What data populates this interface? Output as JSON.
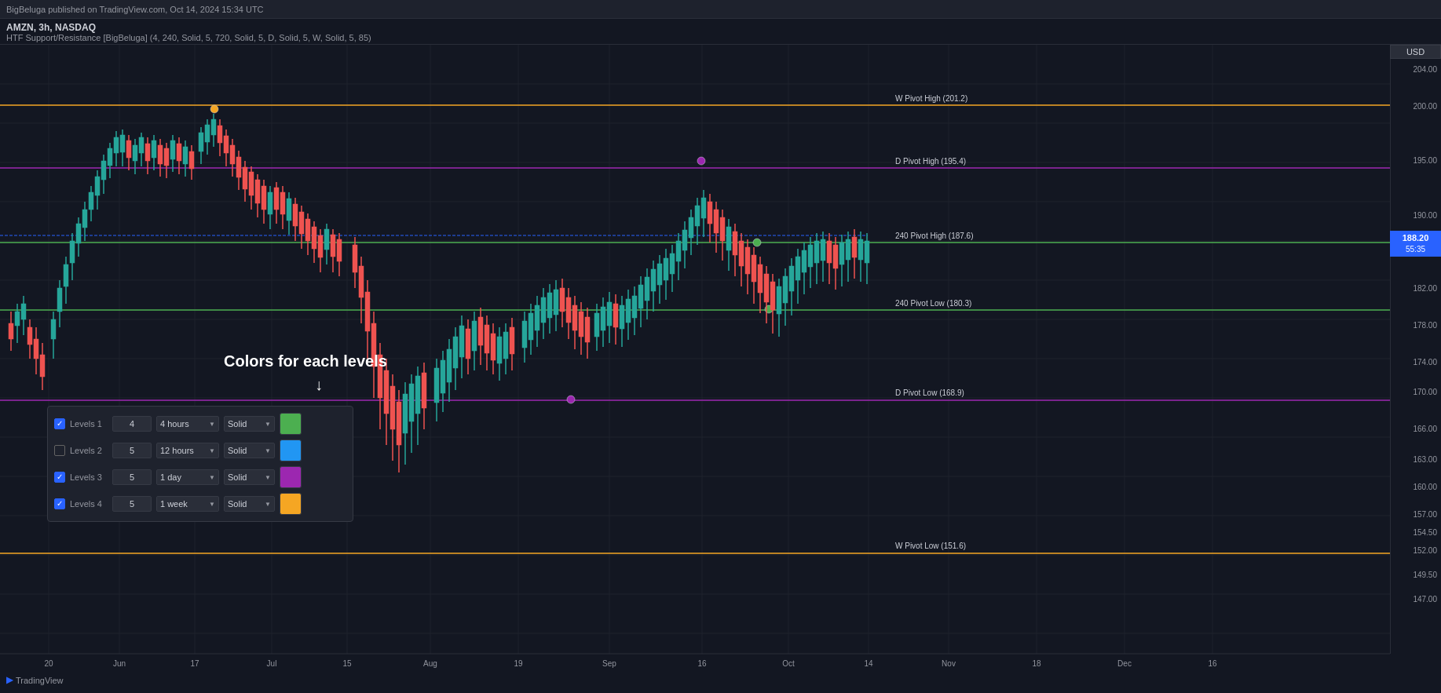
{
  "topbar": {
    "text": "BigBeluga published on TradingView.com, Oct 14, 2024 15:34 UTC"
  },
  "header": {
    "symbol": "AMZN, 3h, NASDAQ",
    "indicator": "HTF Support/Resistance [BigBeluga] (4, 240, Solid, 5, 720, Solid, 5, D, Solid, 5, W, Solid, 5, 85)"
  },
  "usd_button": "USD",
  "current_price": "188.20",
  "current_price_time": "55:35",
  "price_levels": {
    "w_pivot_high": {
      "value": 201.2,
      "label": "W Pivot High (201.2)",
      "color": "#f5a623",
      "y_pct": 9.5
    },
    "d_pivot_high": {
      "value": 195.4,
      "label": "D Pivot High (195.4)",
      "color": "#9c27b0",
      "y_pct": 19.5
    },
    "pivot_240_high": {
      "value": 187.6,
      "label": "240 Pivot High (187.6)",
      "color": "#4caf50",
      "y_pct": 31.5
    },
    "pivot_240_low": {
      "value": 180.3,
      "label": "240 Pivot Low (180.3)",
      "color": "#4caf50",
      "y_pct": 42.0
    },
    "d_pivot_low": {
      "value": 168.9,
      "label": "D Pivot Low (168.9)",
      "color": "#9c27b0",
      "y_pct": 56.0
    },
    "w_pivot_low": {
      "value": 151.6,
      "label": "W Pivot Low (151.6)",
      "color": "#f5a623",
      "y_pct": 81.5
    }
  },
  "price_axis": [
    {
      "value": "204.00",
      "y_pct": 5
    },
    {
      "value": "200.00",
      "y_pct": 10.5
    },
    {
      "value": "195.00",
      "y_pct": 19.0
    },
    {
      "value": "190.00",
      "y_pct": 27.5
    },
    {
      "value": "188.20",
      "y_pct": 30.5
    },
    {
      "value": "182.00",
      "y_pct": 40.0
    },
    {
      "value": "178.00",
      "y_pct": 46.0
    },
    {
      "value": "174.00",
      "y_pct": 52.0
    },
    {
      "value": "170.00",
      "y_pct": 57.5
    },
    {
      "value": "166.00",
      "y_pct": 63.5
    },
    {
      "value": "163.00",
      "y_pct": 68.0
    },
    {
      "value": "160.00",
      "y_pct": 72.5
    },
    {
      "value": "157.00",
      "y_pct": 77.0
    },
    {
      "value": "154.50",
      "y_pct": 80.5
    },
    {
      "value": "152.00",
      "y_pct": 83.5
    },
    {
      "value": "149.50",
      "y_pct": 87.0
    },
    {
      "value": "147.00",
      "y_pct": 91.0
    }
  ],
  "time_labels": [
    {
      "label": "20",
      "x_pct": 3.5
    },
    {
      "label": "Jun",
      "x_pct": 8.5
    },
    {
      "label": "17",
      "x_pct": 14.0
    },
    {
      "label": "Jul",
      "x_pct": 19.5
    },
    {
      "label": "15",
      "x_pct": 25.0
    },
    {
      "label": "Aug",
      "x_pct": 31.0
    },
    {
      "label": "19",
      "x_pct": 37.5
    },
    {
      "label": "Sep",
      "x_pct": 44.0
    },
    {
      "label": "16",
      "x_pct": 50.5
    },
    {
      "label": "Oct",
      "x_pct": 56.5
    },
    {
      "label": "14",
      "x_pct": 62.5
    },
    {
      "label": "Nov",
      "x_pct": 68.0
    },
    {
      "label": "18",
      "x_pct": 74.5
    },
    {
      "label": "Dec",
      "x_pct": 80.5
    },
    {
      "label": "16",
      "x_pct": 87.0
    }
  ],
  "annotation_text": "Colors for each levels",
  "annotation_arrow": "↓",
  "settings": {
    "rows": [
      {
        "id": "levels1",
        "checked": true,
        "label": "Levels 1",
        "number": "4",
        "timeframe": "4 hours",
        "style": "Solid",
        "color": "#4caf50",
        "color_hex": "#4caf50"
      },
      {
        "id": "levels2",
        "checked": false,
        "label": "Levels 2",
        "number": "5",
        "timeframe": "12 hours",
        "style": "Solid",
        "color": "#2196f3",
        "color_hex": "#2196f3"
      },
      {
        "id": "levels3",
        "checked": true,
        "label": "Levels 3",
        "number": "5",
        "timeframe": "1 day",
        "style": "Solid",
        "color": "#9c27b0",
        "color_hex": "#9c27b0"
      },
      {
        "id": "levels4",
        "checked": true,
        "label": "Levels 4",
        "number": "5",
        "timeframe": "1 week",
        "style": "Solid",
        "color": "#f5a623",
        "color_hex": "#f5a623"
      }
    ]
  },
  "tv_logo": "▶ TradingView"
}
